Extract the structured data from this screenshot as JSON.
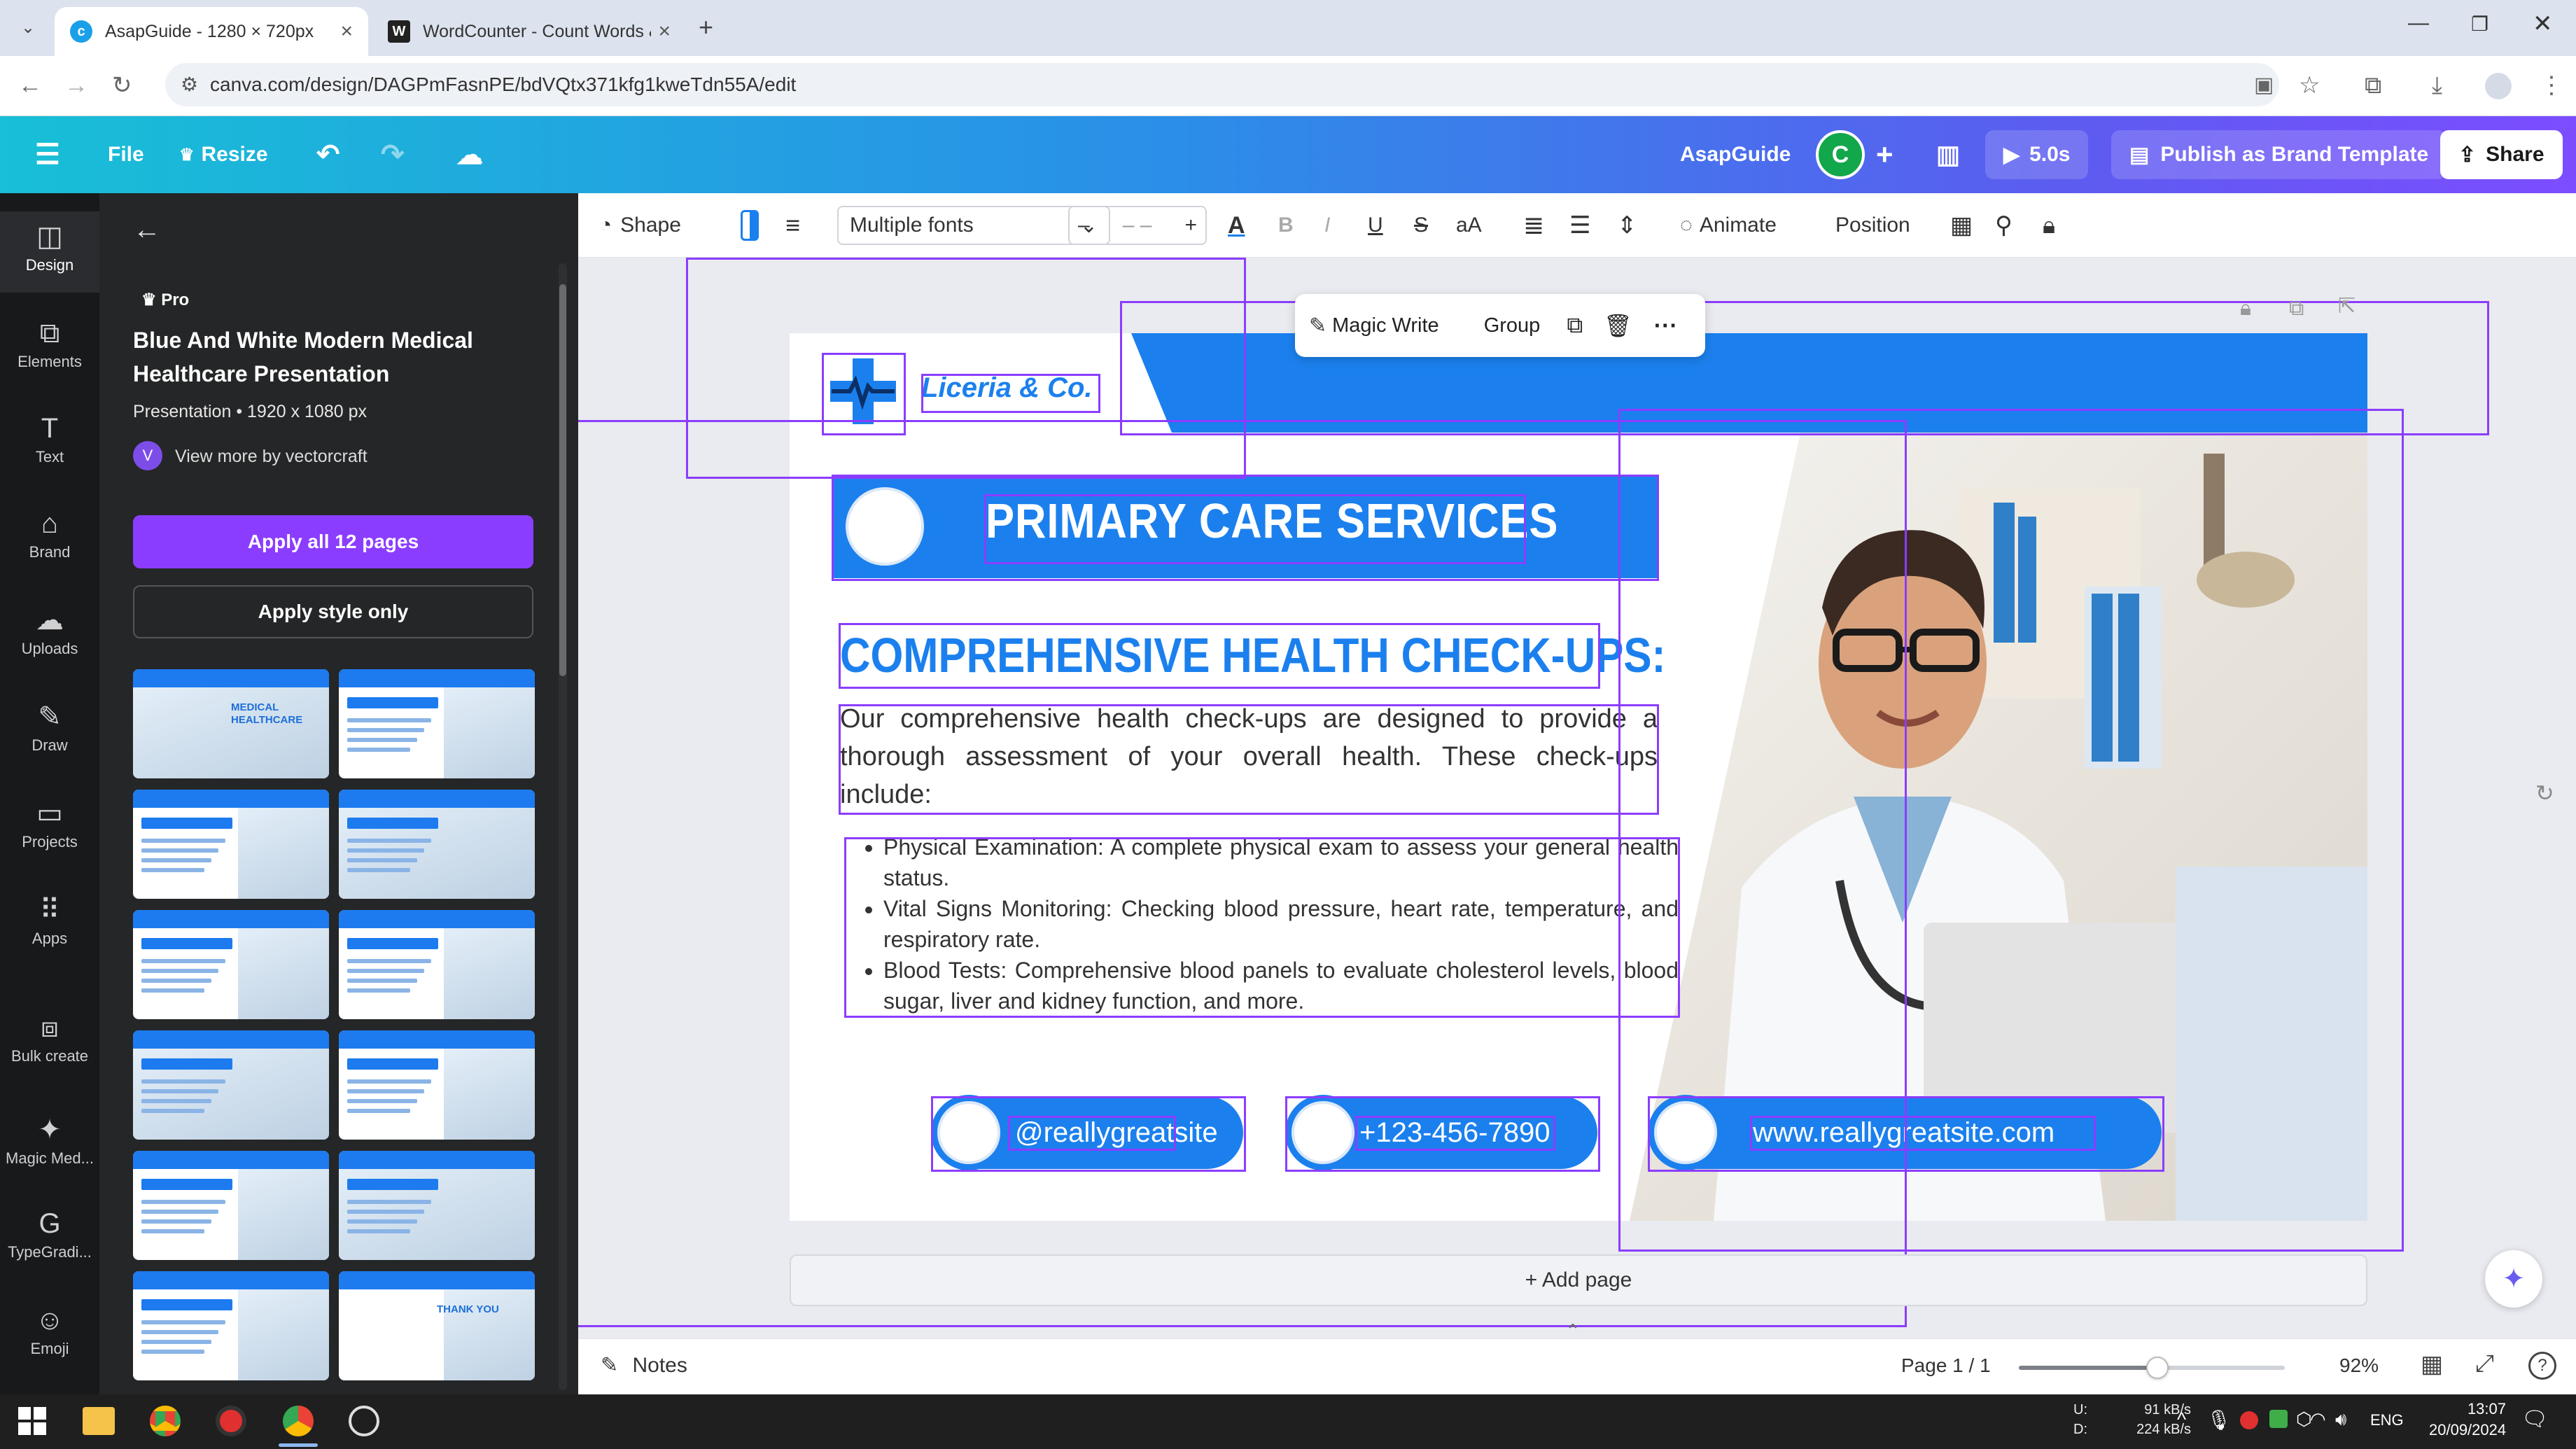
{
  "browser": {
    "tabs": [
      {
        "title": "AsapGuide - 1280 × 720px",
        "active": true
      },
      {
        "title": "WordCounter - Count Words &",
        "active": false
      }
    ],
    "favicon_w": "W",
    "url": "canva.com/design/DAGPmFasnPE/bdVQtx371kfg1kweTdn55A/edit"
  },
  "header": {
    "file": "File",
    "resize": "Resize",
    "brand_name": "AsapGuide",
    "avatar_letter": "C",
    "duration": "5.0s",
    "publish": "Publish as Brand Template",
    "share": "Share"
  },
  "rail": [
    {
      "label": "Design",
      "icon": "design-icon",
      "glyph": "◫"
    },
    {
      "label": "Elements",
      "icon": "elements-icon",
      "glyph": "⧉"
    },
    {
      "label": "Text",
      "icon": "text-icon",
      "glyph": "T"
    },
    {
      "label": "Brand",
      "icon": "brand-icon",
      "glyph": "⌂"
    },
    {
      "label": "Uploads",
      "icon": "uploads-icon",
      "glyph": "☁"
    },
    {
      "label": "Draw",
      "icon": "draw-icon",
      "glyph": "✎"
    },
    {
      "label": "Projects",
      "icon": "projects-icon",
      "glyph": "▭"
    },
    {
      "label": "Apps",
      "icon": "apps-icon",
      "glyph": "⠿"
    },
    {
      "label": "Bulk create",
      "icon": "bulk-create-icon",
      "glyph": "⧈"
    },
    {
      "label": "Magic Med...",
      "icon": "magic-media-icon",
      "glyph": "✦"
    },
    {
      "label": "TypeGradi...",
      "icon": "typegradient-icon",
      "glyph": "G"
    },
    {
      "label": "Emoji",
      "icon": "emoji-icon",
      "glyph": "☺"
    }
  ],
  "panel": {
    "badge": "Pro",
    "title": "Blue And White Modern Medical Healthcare Presentation",
    "meta": "Presentation • 1920 x 1080 px",
    "author_initial": "V",
    "author": "View more by vectorcraft",
    "apply_all": "Apply all 12 pages",
    "apply_style": "Apply style only",
    "thumbs": [
      {
        "caption": "MEDICAL HEALTHCARE"
      },
      {
        "caption": ""
      },
      {
        "caption": ""
      },
      {
        "caption": ""
      },
      {
        "caption": ""
      },
      {
        "caption": ""
      },
      {
        "caption": ""
      },
      {
        "caption": ""
      },
      {
        "caption": ""
      },
      {
        "caption": ""
      },
      {
        "caption": ""
      },
      {
        "caption": "THANK YOU"
      }
    ]
  },
  "toolbar": {
    "shape": "Shape",
    "font": "Multiple fonts",
    "minus": "–",
    "size": "– –",
    "plus": "+",
    "animate": "Animate",
    "position": "Position"
  },
  "floating": {
    "magic_write": "Magic Write",
    "group": "Group"
  },
  "slide": {
    "logo": "Liceria & Co.",
    "banner": "PRIMARY CARE SERVICES",
    "heading": "COMPREHENSIVE HEALTH CHECK-UPS:",
    "paragraph": "Our comprehensive health check-ups are designed to provide a thorough assessment of your overall health. These check-ups include:",
    "bullets": [
      "Physical Examination: A complete physical exam to assess your general health status.",
      "Vital Signs Monitoring: Checking blood pressure, heart rate, temperature, and respiratory rate.",
      "Blood Tests: Comprehensive blood panels to evaluate cholesterol levels, blood sugar, liver and kidney function, and more."
    ],
    "social": "@reallygreatsite",
    "phone": "+123-456-7890",
    "website": "www.reallygreatsite.com"
  },
  "canvas": {
    "add_page": "+ Add page"
  },
  "bottom": {
    "notes": "Notes",
    "page": "Page 1 / 1",
    "zoom": "92%",
    "zoom_level": 0.52
  },
  "taskbar": {
    "net_up_label": "U:",
    "net_up": "91 kB/s",
    "net_down_label": "D:",
    "net_down": "224 kB/s",
    "lang": "ENG",
    "time": "13:07",
    "date": "20/09/2024"
  },
  "colors": {
    "accent": "#8b3dff",
    "slide_blue": "#1b80ee",
    "panel": "#252627"
  }
}
